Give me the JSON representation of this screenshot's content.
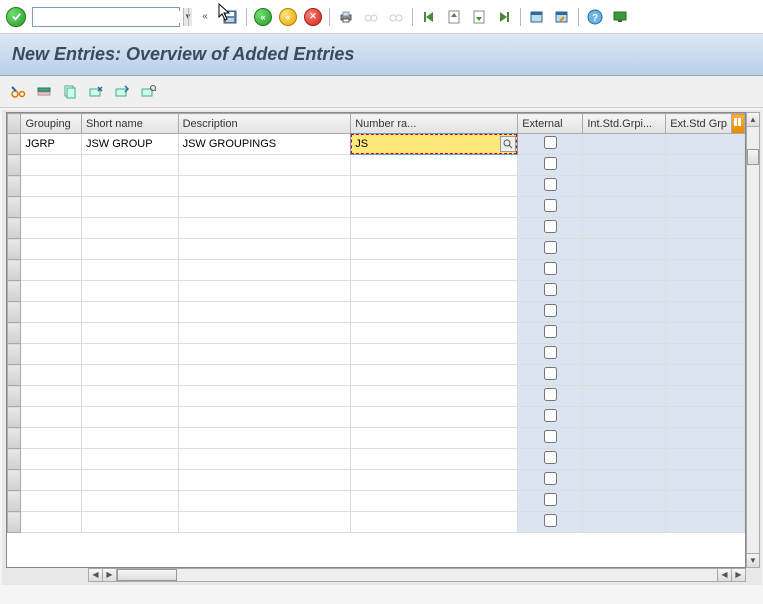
{
  "title": "New Entries: Overview of Added Entries",
  "columns": {
    "grouping": "Grouping",
    "short_name": "Short name",
    "description": "Description",
    "number_range": "Number ra...",
    "external": "External",
    "int_std": "Int.Std.Grpi...",
    "ext_std": "Ext.Std Grp"
  },
  "rows": [
    {
      "grouping": "JGRP",
      "short_name": "JSW GROUP",
      "description": "JSW GROUPINGS",
      "number_range": "JS",
      "external": false,
      "active_col": "number_range"
    }
  ],
  "empty_row_count": 18
}
